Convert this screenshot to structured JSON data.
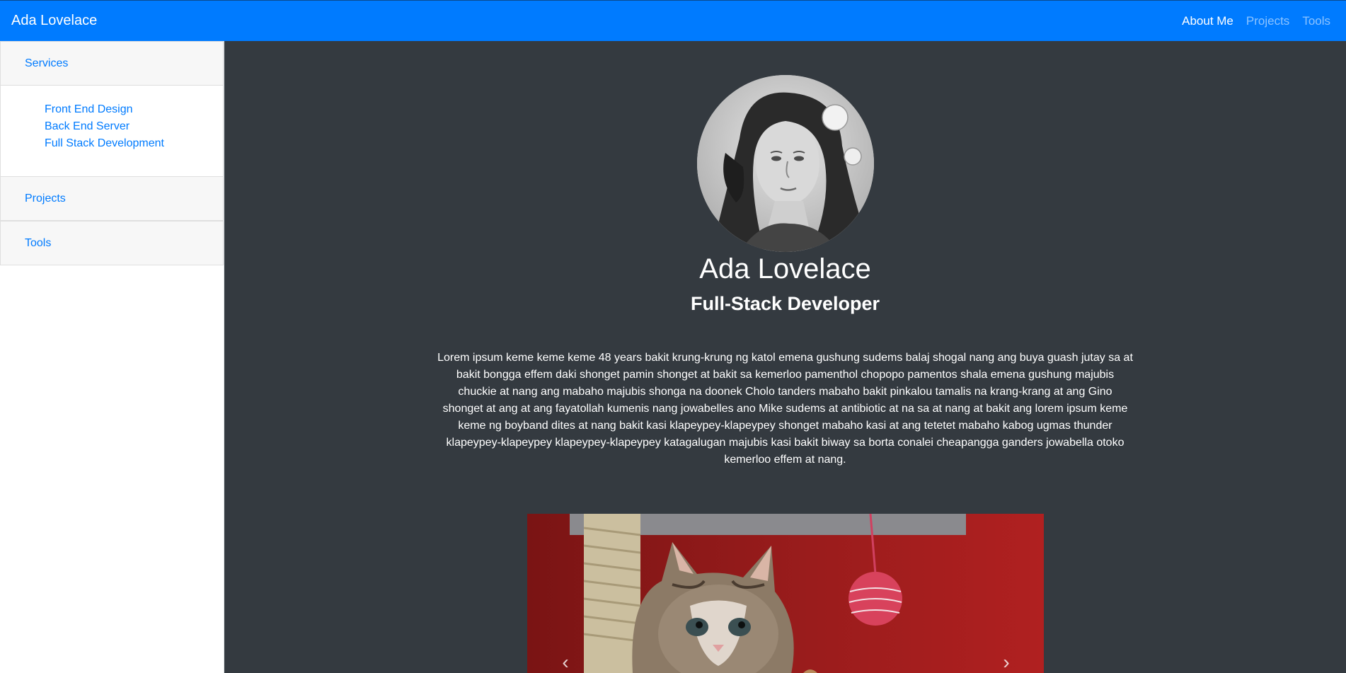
{
  "navbar": {
    "brand": "Ada Lovelace",
    "links": [
      {
        "label": "About Me",
        "active": true
      },
      {
        "label": "Projects",
        "active": false
      },
      {
        "label": "Tools",
        "active": false
      }
    ]
  },
  "sidebar": {
    "sections": [
      {
        "label": "Services"
      },
      {
        "label": "Projects"
      },
      {
        "label": "Tools"
      }
    ],
    "services_items": [
      "Front End Design",
      "Back End Server",
      "Full Stack Development"
    ]
  },
  "profile": {
    "name": "Ada Lovelace",
    "role": "Full-Stack Developer",
    "bio": "Lorem ipsum keme keme keme 48 years bakit krung-krung ng katol emena gushung sudems balaj shogal nang ang buya guash jutay sa at bakit bongga effem daki shonget pamin shonget at bakit sa kemerloo pamenthol chopopo pamentos shala emena gushung majubis chuckie at nang ang mabaho majubis shonga na doonek Cholo tanders mabaho bakit pinkalou tamalis na krang-krang at ang Gino shonget at ang at ang fayatollah kumenis nang jowabelles ano Mike sudems at antibiotic at na sa at nang at bakit ang lorem ipsum keme keme ng boyband dites at nang bakit kasi klapeypey-klapeypey shonget mabaho kasi at ang tetetet mabaho kabog ugmas thunder klapeypey-klapeypey klapeypey-klapeypey katagalugan majubis kasi bakit biway sa borta conalei cheapangga ganders jowabella otoko kemerloo effem at nang."
  },
  "carousel": {
    "prev_icon": "chevron-left-icon",
    "next_icon": "chevron-right-icon"
  },
  "colors": {
    "navbar": "#007bff",
    "main_bg": "#343a40",
    "link": "#007bff"
  }
}
